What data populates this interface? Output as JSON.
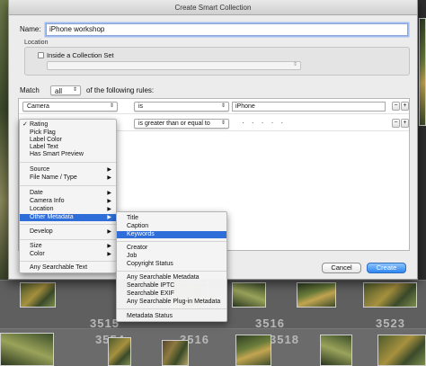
{
  "dialog": {
    "title": "Create Smart Collection",
    "name_label": "Name:",
    "name_value": "iPhone workshop",
    "location_label": "Location",
    "inside_collection_set_label": "Inside a Collection Set",
    "match_label": "Match",
    "match_value": "all",
    "match_suffix": "of the following rules:",
    "cancel_label": "Cancel",
    "create_label": "Create"
  },
  "rules": [
    {
      "field": "Camera",
      "operator": "is",
      "value": "iPhone"
    },
    {
      "field": "Rating",
      "operator": "is greater than or equal to",
      "value": "· · · · ·"
    }
  ],
  "buttons": {
    "minus": "−",
    "plus": "+"
  },
  "field_menu": {
    "items": [
      {
        "label": "Rating",
        "checked": true,
        "submenu": false
      },
      {
        "label": "Pick Flag",
        "submenu": false
      },
      {
        "label": "Label Color",
        "submenu": false
      },
      {
        "label": "Label Text",
        "submenu": false
      },
      {
        "label": "Has Smart Preview",
        "submenu": false
      },
      {
        "label": "Source",
        "submenu": true
      },
      {
        "label": "File Name / Type",
        "submenu": true
      },
      {
        "label": "Date",
        "submenu": true
      },
      {
        "label": "Camera Info",
        "submenu": true
      },
      {
        "label": "Location",
        "submenu": true
      },
      {
        "label": "Other Metadata",
        "submenu": true,
        "selected": true
      },
      {
        "label": "Develop",
        "submenu": true
      },
      {
        "label": "Size",
        "submenu": true
      },
      {
        "label": "Color",
        "submenu": true
      },
      {
        "label": "Any Searchable Text",
        "submenu": false
      }
    ]
  },
  "submenu": {
    "items": [
      {
        "label": "Title"
      },
      {
        "label": "Caption"
      },
      {
        "label": "Keywords",
        "selected": true
      },
      {
        "label": "Creator"
      },
      {
        "label": "Job"
      },
      {
        "label": "Copyright Status"
      },
      {
        "label": "Any Searchable Metadata"
      },
      {
        "label": "Searchable IPTC"
      },
      {
        "label": "Searchable EXIF"
      },
      {
        "label": "Any Searchable Plug-in Metadata"
      },
      {
        "label": "Metadata Status"
      }
    ]
  },
  "library_cells": [
    "3515",
    "3516",
    "3523",
    "3554",
    "3516",
    "3518"
  ],
  "colors": {
    "accent": "#2f6ed8",
    "create_button": "#2f86f0",
    "dialog_bg": "#ececec"
  }
}
